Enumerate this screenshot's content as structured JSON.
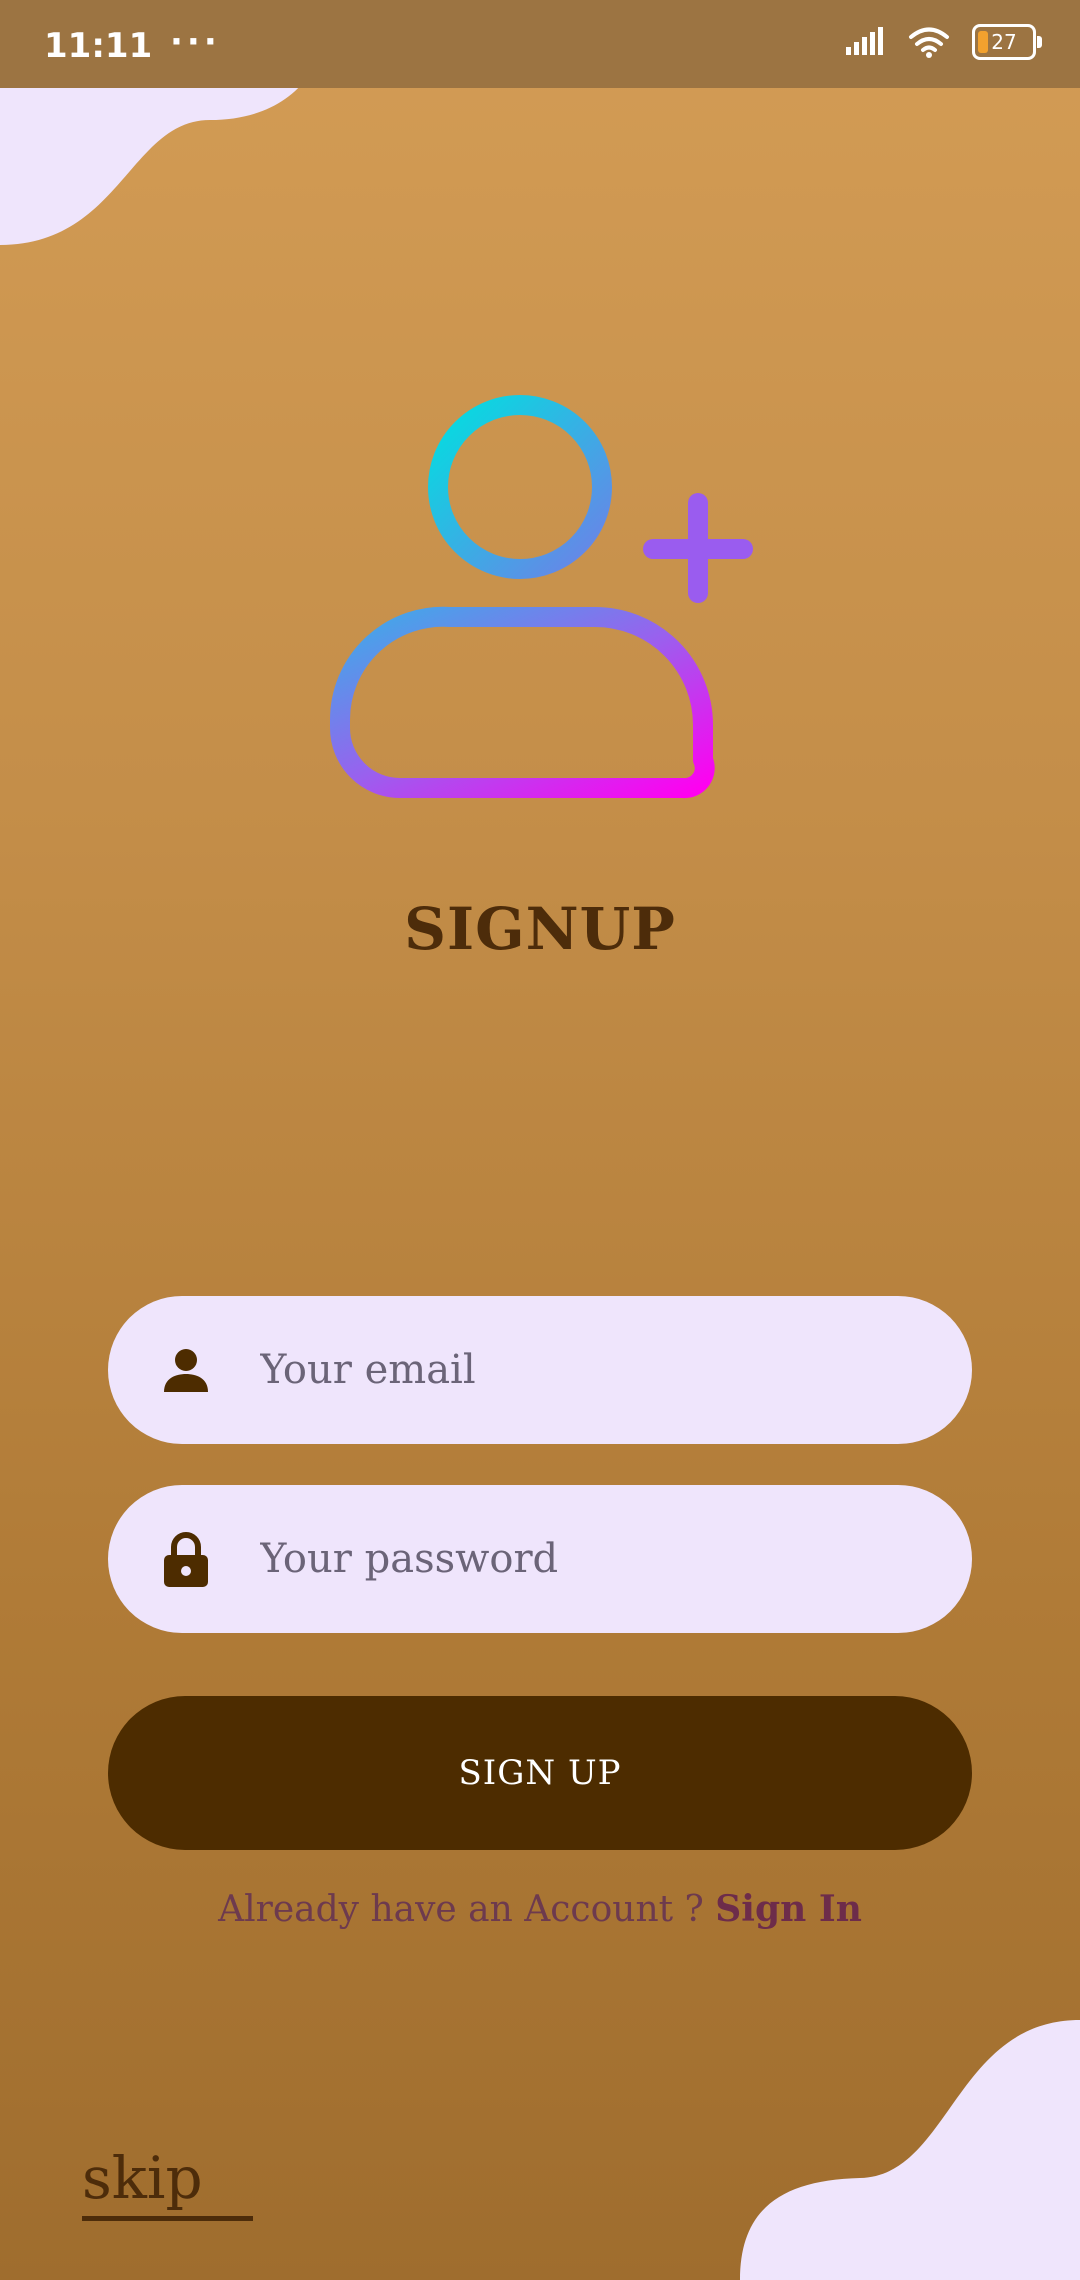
{
  "status_bar": {
    "time": "11:11",
    "dots": "···",
    "battery_level": "27"
  },
  "hero": {
    "icon": "add-user-icon"
  },
  "page": {
    "title": "SIGNUP"
  },
  "form": {
    "email_placeholder": "Your email",
    "email_value": "",
    "email_icon": "person-icon",
    "password_placeholder": "Your password",
    "password_value": "",
    "password_icon": "lock-icon",
    "submit_label": "SIGN UP"
  },
  "footer": {
    "account_prompt": "Already have an Account ? ",
    "sign_in_label": "Sign In",
    "skip_label": "skip"
  },
  "colors": {
    "background_top": "#d39c55",
    "background_bottom": "#9f6d2e",
    "blob": "#efe5fc",
    "primary_dark": "#4d2c00",
    "link": "#6d2c4a"
  }
}
